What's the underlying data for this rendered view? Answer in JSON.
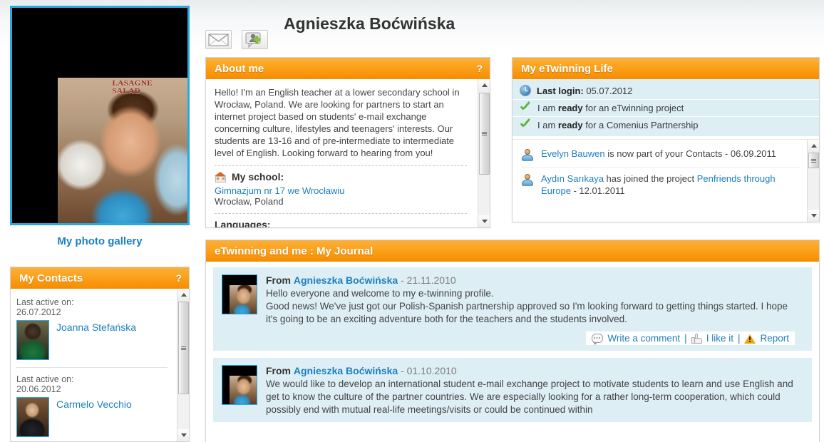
{
  "profile": {
    "name": "Agnieszka Boćwińska",
    "photo_alt": "Profile photo",
    "gallery_link": "My photo gallery",
    "photo_sign": "LASAGNE\nSALAD",
    "actions": [
      {
        "name": "send-message",
        "icon": "envelope-icon"
      },
      {
        "name": "add-contact",
        "icon": "add-contact-icon"
      }
    ]
  },
  "about": {
    "title": "About me",
    "help": "?",
    "text": "Hello! I'm an English teacher at a lower secondary school in Wrocław, Poland. We are looking for partners to start an internet project based on students' e-mail exchange concerning culture, lifestyles and teenagers' interests. Our students are 13-16 and of pre-intermediate to intermediate level of English. Looking forward to hearing from you!",
    "school_label": "My school:",
    "school_name": "Gimnazjum nr 17 we Wrocławiu",
    "school_place": "Wrocław, Poland",
    "languages_label": "Languages:"
  },
  "life": {
    "title": "My eTwinning Life",
    "status": [
      {
        "icon": "clock-icon",
        "bold_prefix": "Last login:",
        "text": " 05.07.2012",
        "lead": ""
      },
      {
        "icon": "check-icon",
        "lead": "I am ",
        "bold_prefix": "ready",
        "text": " for an eTwinning project"
      },
      {
        "icon": "check-icon",
        "lead": "I am ",
        "bold_prefix": "ready",
        "text": " for a Comenius Partnership"
      }
    ],
    "feed": [
      {
        "icon": "user-icon",
        "parts": [
          {
            "type": "link",
            "text": "Evelyn Bauwen"
          },
          {
            "type": "text",
            "text": " is now part of your Contacts - 06.09.2011"
          }
        ]
      },
      {
        "icon": "user-icon",
        "parts": [
          {
            "type": "link",
            "text": "Aydın Sarıkaya"
          },
          {
            "type": "text",
            "text": " has joined the project "
          },
          {
            "type": "link",
            "text": "Penfriends through Europe"
          },
          {
            "type": "text",
            "text": " - 12.01.2011"
          }
        ]
      }
    ]
  },
  "contacts": {
    "title": "My Contacts",
    "help": "?",
    "last_active_label": "Last active on:",
    "items": [
      {
        "date": "26.07.2012",
        "name": "Joanna Stefańska",
        "thumb": "thumb-a"
      },
      {
        "date": "20.06.2012",
        "name": "Carmelo Vecchio",
        "thumb": "thumb-b"
      }
    ]
  },
  "journal": {
    "title": "eTwinning and me : My Journal",
    "from_label": "From",
    "entries": [
      {
        "author": "Agnieszka Boćwińska",
        "date": "- 21.11.2010",
        "text": "Hello everyone and welcome to my e-twinning profile.\nGood news! We've just got our Polish-Spanish partnership approved so I'm looking forward to getting things started. I hope it's going to be an exciting adventure both for the teachers and the students involved.",
        "actions": {
          "comment": "Write a comment",
          "like": "I like it",
          "report": "Report",
          "divider": "|"
        }
      },
      {
        "author": "Agnieszka Boćwińska",
        "date": "- 01.10.2010",
        "text": "We would like to develop an international student e-mail exchange project to motivate students to learn and use English and get to know the culture of the partner countries. We are especially looking for a rather long-term cooperation, which could possibly end with mutual real-life meetings/visits or could be continued within"
      }
    ]
  },
  "colors": {
    "accent_orange": "#f78c00",
    "header_orange_light": "#fbb03b",
    "link_blue": "#1d7fc0",
    "panel_blue": "#ddeef5",
    "photo_border": "#29a9e0",
    "check_green": "#5db83a",
    "warn_yellow": "#f0a30a"
  }
}
